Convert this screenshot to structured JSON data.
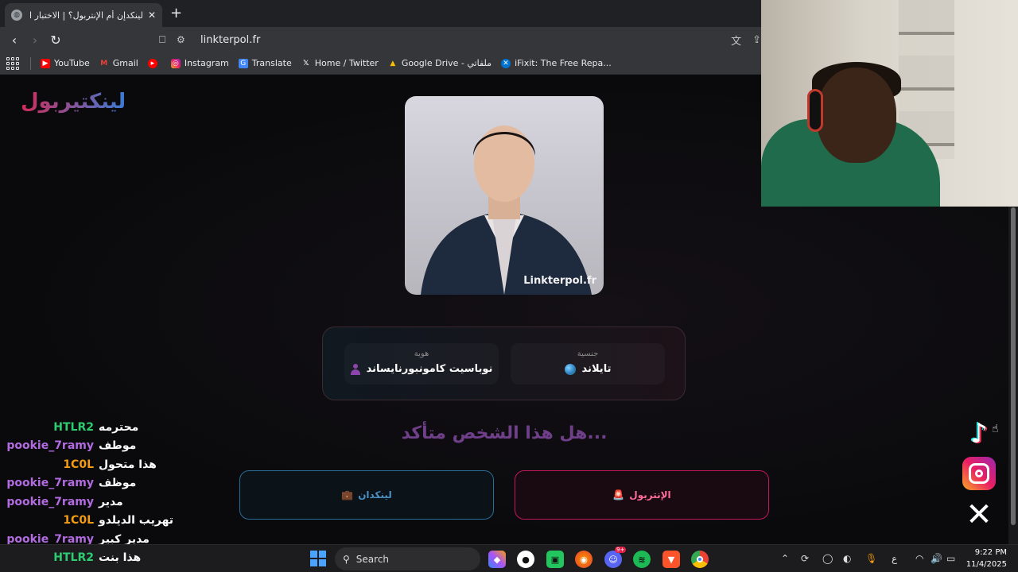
{
  "browser": {
    "tab_title": "لينكدإن أم الإنتربول؟ | الاختبار الأكثر",
    "url": "linkterpol.fr",
    "bookmarks": [
      {
        "label": "YouTube",
        "icon": "youtube-icon"
      },
      {
        "label": "Gmail",
        "icon": "gmail-icon"
      },
      {
        "label": "",
        "icon": "youtube-music-icon"
      },
      {
        "label": "Instagram",
        "icon": "instagram-icon"
      },
      {
        "label": "Translate",
        "icon": "translate-icon"
      },
      {
        "label": "Home / Twitter",
        "icon": "x-icon"
      },
      {
        "label": "Google Drive - ملفاتي",
        "icon": "drive-icon"
      },
      {
        "label": "iFixit: The Free Repa...",
        "icon": "ifixit-icon"
      }
    ]
  },
  "page": {
    "logo": "لينكتيربول",
    "photo_watermark": "Linkterpol.fr",
    "nationality_label": "جنسية",
    "nationality_value": "تايلاند",
    "identity_label": "هوية",
    "identity_value": "نوباسيت كامونبورنايساند",
    "question": "...هل هذا الشخص متأكد",
    "interpol_button": "الإنتربول",
    "linkedin_button": "لينكدان"
  },
  "chat": [
    {
      "user": "HTLR2",
      "msg": "محترمه",
      "color": "green"
    },
    {
      "user": "pookie_7ramy",
      "msg": "موطف",
      "color": "purple"
    },
    {
      "user": "1C0L",
      "msg": "هذا متحول",
      "color": "orange"
    },
    {
      "user": "pookie_7ramy",
      "msg": "موظف",
      "color": "purple"
    },
    {
      "user": "pookie_7ramy",
      "msg": "مدير",
      "color": "purple"
    },
    {
      "user": "1C0L",
      "msg": "تهريب الديلدو",
      "color": "orange"
    },
    {
      "user": "pookie_7ramy",
      "msg": "مدير كبير",
      "color": "purple"
    },
    {
      "user": "HTLR2",
      "msg": "هذا بنت",
      "color": "green"
    }
  ],
  "taskbar": {
    "search_label": "Search",
    "lang_indicator": "ع",
    "time": "9:22 PM",
    "date": "11/4/2025",
    "discord_badge": "9+"
  },
  "colors": {
    "interpol_accent": "#c2185b",
    "linkedin_accent": "#2a6c9a",
    "question_color": "#6f3f8a"
  }
}
